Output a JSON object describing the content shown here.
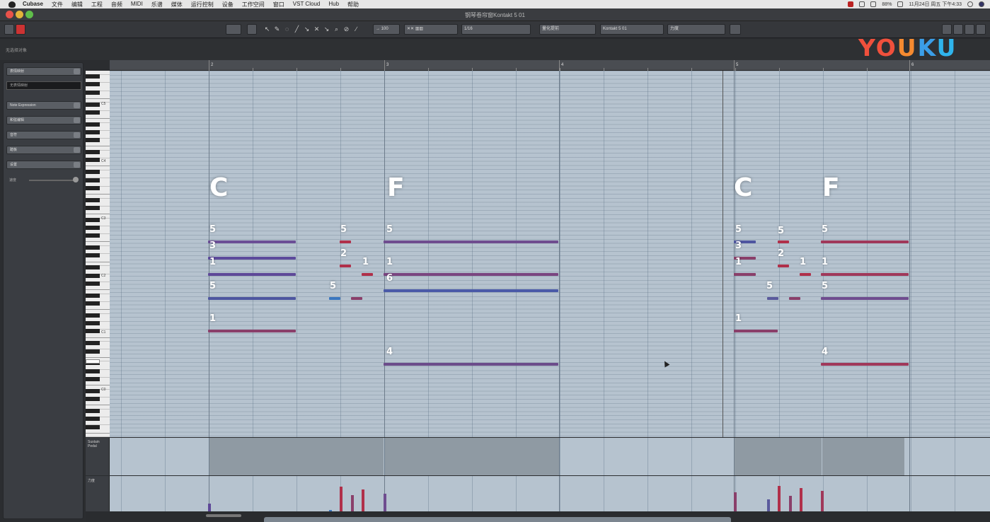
{
  "menubar": {
    "items": [
      "Cubase",
      "文件",
      "编辑",
      "工程",
      "音频",
      "MIDI",
      "乐谱",
      "媒体",
      "运行控制",
      "设备",
      "工作空间",
      "窗口",
      "VST Cloud",
      "Hub",
      "帮助"
    ],
    "battery": "88%",
    "datetime": "11月24日 周五 下午4:33"
  },
  "window": {
    "title": "钢琴卷帘窗Kontakt 5 01"
  },
  "toolbar": {
    "quantize": "1/16",
    "length": "1/16",
    "chord": "量化提前",
    "instrument": "Kontakt 5 01",
    "track": "力度"
  },
  "info": {
    "text": "无选择对象"
  },
  "logo": {
    "text": [
      "Y",
      "O",
      "U",
      "K",
      "U"
    ]
  },
  "inspector": {
    "rows": [
      "表情映射",
      "Note Expression",
      "和弦编辑",
      "音符",
      "踏板",
      "设置"
    ],
    "field": "无表情映射",
    "slider_label": "速度"
  },
  "keyboard": {
    "octaves": [
      "C5",
      "C4",
      "C3",
      "C2",
      "C1",
      "C0"
    ]
  },
  "ruler": {
    "bars": [
      "2",
      "3",
      "4",
      "5",
      "6"
    ]
  },
  "chords": [
    {
      "name": "C"
    },
    {
      "name": "F"
    },
    {
      "name": "C"
    },
    {
      "name": "F"
    }
  ],
  "notes": [
    {
      "label": "5",
      "color": "#6b4e96"
    },
    {
      "label": "3",
      "color": "#5c4a9c"
    },
    {
      "label": "1",
      "color": "#5e4898"
    },
    {
      "label": "5",
      "color": "#4e56a0"
    },
    {
      "label": "1",
      "color": "#8a3f6a"
    },
    {
      "label": "5",
      "color": "#b0304a"
    },
    {
      "label": "2",
      "color": "#b0304a"
    },
    {
      "label": "1",
      "color": "#b0304a"
    },
    {
      "label": "5",
      "color": "#3b77bf"
    },
    {
      "label": "",
      "color": "#8a3f6a"
    },
    {
      "label": "5",
      "color": "#6f4c8f"
    },
    {
      "label": "1",
      "color": "#7a4580"
    },
    {
      "label": "6",
      "color": "#4a5aa8"
    },
    {
      "label": "4",
      "color": "#6c4c8a"
    },
    {
      "label": "5",
      "color": "#4e56a0"
    },
    {
      "label": "3",
      "color": "#8a3f6a"
    },
    {
      "label": "1",
      "color": "#8a3f6a"
    },
    {
      "label": "1",
      "color": "#8a3f6a"
    },
    {
      "label": "5",
      "color": "#b0304a"
    },
    {
      "label": "2",
      "color": "#b0304a"
    },
    {
      "label": "1",
      "color": "#b0304a"
    },
    {
      "label": "5",
      "color": "#5a5a9c"
    },
    {
      "label": "",
      "color": "#8a3f6a"
    },
    {
      "label": "5",
      "color": "#a0385a"
    },
    {
      "label": "1",
      "color": "#a0385a"
    },
    {
      "label": "5",
      "color": "#6f4c8f"
    },
    {
      "label": "4",
      "color": "#a0385a"
    }
  ],
  "lanes": {
    "sustain_label": "Sustain Pedal",
    "velocity_label": "力度"
  },
  "velocities": [
    {
      "value": 0.22,
      "color": "#5e4898"
    },
    {
      "value": 0.05,
      "color": "#3b77bf"
    },
    {
      "value": 0.7,
      "color": "#b0304a"
    },
    {
      "value": 0.47,
      "color": "#8a3f6a"
    },
    {
      "value": 0.62,
      "color": "#b0304a"
    },
    {
      "value": 0.5,
      "color": "#6f4c8f"
    },
    {
      "value": 0.55,
      "color": "#8a3f6a"
    },
    {
      "value": 0.34,
      "color": "#5a5a9c"
    },
    {
      "value": 0.72,
      "color": "#b0304a"
    },
    {
      "value": 0.45,
      "color": "#8a3f6a"
    },
    {
      "value": 0.66,
      "color": "#b0304a"
    },
    {
      "value": 0.58,
      "color": "#a0385a"
    }
  ]
}
